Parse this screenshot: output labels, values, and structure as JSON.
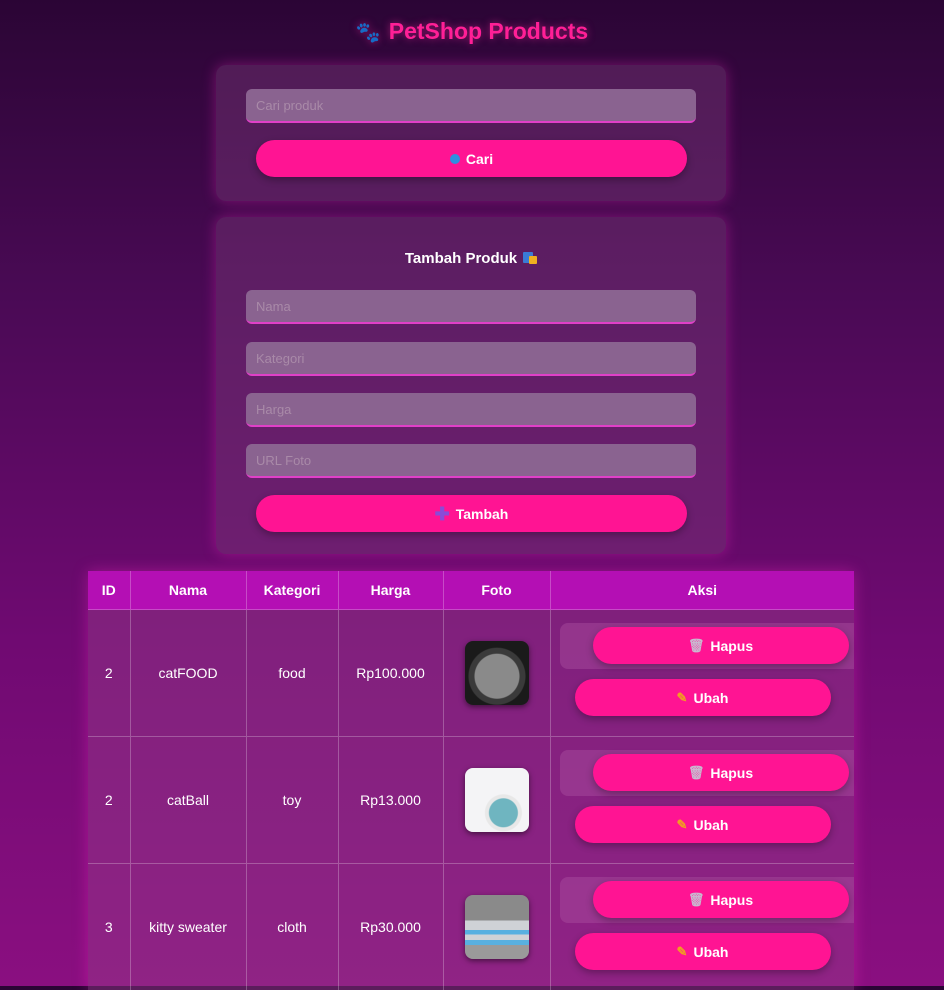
{
  "header": {
    "title": "PetShop Products",
    "paw_icon": "paw-icon"
  },
  "search": {
    "placeholder": "Cari produk",
    "button_label": "Cari",
    "button_icon": "blue-dot-icon"
  },
  "add_form": {
    "title": "Tambah Produk",
    "title_icon": "shopping-bags-icon",
    "fields": [
      {
        "name": "nama",
        "placeholder": "Nama"
      },
      {
        "name": "kategori",
        "placeholder": "Kategori"
      },
      {
        "name": "harga",
        "placeholder": "Harga"
      },
      {
        "name": "foto",
        "placeholder": "URL Foto"
      }
    ],
    "button_label": "Tambah",
    "button_icon": "plus-icon"
  },
  "table": {
    "columns": [
      "ID",
      "Nama",
      "Kategori",
      "Harga",
      "Foto",
      "Aksi"
    ],
    "rows": [
      {
        "id": "2",
        "nama": "catFOOD",
        "kategori": "food",
        "harga": "Rp100.000",
        "foto": "cat-eating-photo"
      },
      {
        "id": "2",
        "nama": "catBall",
        "kategori": "toy",
        "harga": "Rp13.000",
        "foto": "cat-ball-toy-photo"
      },
      {
        "id": "3",
        "nama": "kitty sweater",
        "kategori": "cloth",
        "harga": "Rp30.000",
        "foto": "cat-in-sweater-photo"
      }
    ],
    "actions": {
      "delete_label": "Hapus",
      "edit_label": "Ubah",
      "delete_icon": "trash-icon",
      "edit_icon": "pencil-icon"
    }
  },
  "colors": {
    "accent": "#ff1493",
    "header_bg": "#b40fb4",
    "title": "#ff1f96"
  }
}
